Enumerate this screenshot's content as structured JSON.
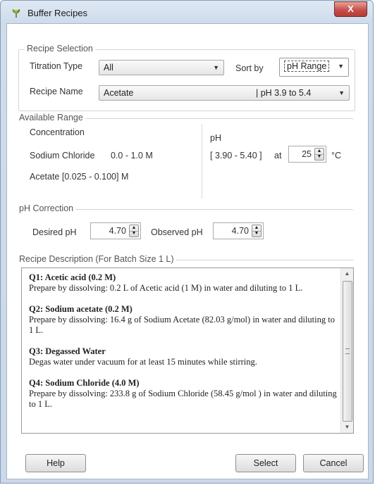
{
  "window": {
    "title": "Buffer Recipes",
    "close_label": "X"
  },
  "recipe_selection": {
    "group_title": "Recipe Selection",
    "titration_label": "Titration Type",
    "titration_value": "All",
    "sort_label": "Sort by",
    "sort_value": "pH Range",
    "recipe_name_label": "Recipe Name",
    "recipe_name_value": "Acetate",
    "recipe_range_value": "| pH 3.9 to 5.4"
  },
  "available_range": {
    "group_title": "Available Range",
    "concentration_label": "Concentration",
    "ph_label": "pH",
    "sodium_chloride_label": "Sodium Chloride",
    "sodium_chloride_range": "0.0 - 1.0 M",
    "acetate_range": "Acetate [0.025 - 0.100] M",
    "ph_range": "[ 3.90 - 5.40 ]",
    "at_label": "at",
    "temperature_value": "25",
    "temperature_unit": "°C"
  },
  "ph_correction": {
    "group_title": "pH Correction",
    "desired_label": "Desired pH",
    "desired_value": "4.70",
    "observed_label": "Observed pH",
    "observed_value": "4.70"
  },
  "recipe_description": {
    "group_title": "Recipe Description (For Batch Size 1 L)",
    "items": [
      {
        "title": "Q1: Acetic acid (0.2 M)",
        "text": "Prepare by dissolving: 0.2 L of Acetic acid (1 M) in water and diluting to 1 L."
      },
      {
        "title": "Q2: Sodium acetate (0.2 M)",
        "text": "Prepare by dissolving: 16.4 g of Sodium Acetate (82.03 g/mol) in water and diluting to 1 L."
      },
      {
        "title": "Q3: Degassed Water",
        "text": "Degas water under vacuum for at least 15 minutes while stirring."
      },
      {
        "title": "Q4: Sodium Chloride (4.0 M)",
        "text": "Prepare by dissolving: 233.8 g of Sodium Chloride (58.45 g/mol ) in water and diluting to 1 L."
      }
    ]
  },
  "buttons": {
    "help": "Help",
    "select": "Select",
    "cancel": "Cancel"
  },
  "icons": {
    "app": "buffer-recipes-app-icon",
    "dropdown": "chevron-down-icon",
    "spin_up": "spin-up-icon",
    "spin_down": "spin-down-icon"
  }
}
